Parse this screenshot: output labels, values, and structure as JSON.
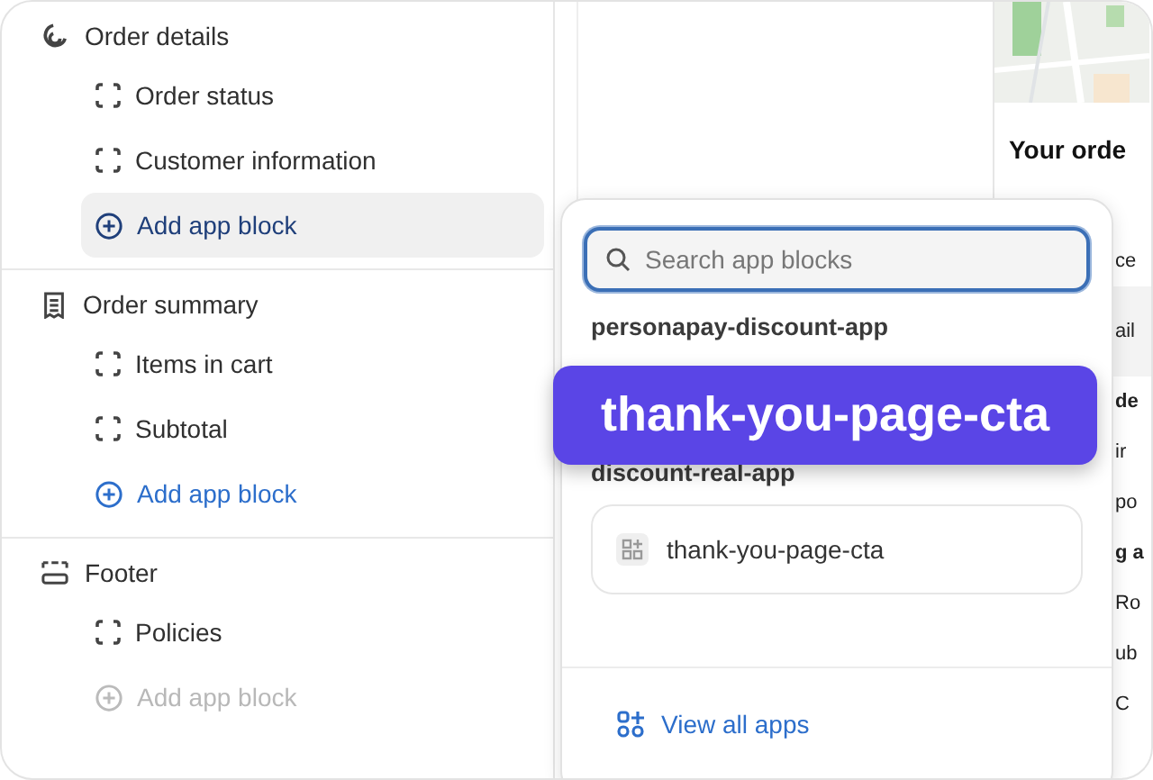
{
  "sections": [
    {
      "title": "Order details",
      "items": [
        {
          "kind": "block",
          "label": "Order status"
        },
        {
          "kind": "block",
          "label": "Customer information"
        },
        {
          "kind": "add",
          "label": "Add app block",
          "selected": true,
          "disabled": false
        }
      ]
    },
    {
      "title": "Order summary",
      "items": [
        {
          "kind": "block",
          "label": "Items in cart"
        },
        {
          "kind": "block",
          "label": "Subtotal"
        },
        {
          "kind": "add",
          "label": "Add app block",
          "selected": false,
          "disabled": false
        }
      ]
    },
    {
      "title": "Footer",
      "items": [
        {
          "kind": "block",
          "label": "Policies"
        },
        {
          "kind": "add",
          "label": "Add app block",
          "selected": false,
          "disabled": true
        }
      ]
    }
  ],
  "preview": {
    "heading": "Your orde",
    "fragments": [
      {
        "text": "ce",
        "bold": false,
        "shaded": false
      },
      {
        "text": "ail",
        "bold": false,
        "shaded": true
      },
      {
        "text": "de",
        "bold": true,
        "shaded": false
      },
      {
        "text": "ir",
        "bold": false,
        "shaded": false
      },
      {
        "text": "po",
        "bold": false,
        "shaded": false
      },
      {
        "text": "g a",
        "bold": true,
        "shaded": false
      },
      {
        "text": "Ro",
        "bold": false,
        "shaded": false
      },
      {
        "text": "ub",
        "bold": false,
        "shaded": false
      },
      {
        "text": "C",
        "bold": false,
        "shaded": false
      }
    ]
  },
  "popup": {
    "search": {
      "placeholder": "Search app blocks"
    },
    "groups": [
      {
        "name": "personapay-discount-app"
      },
      {
        "name": "discount-real-app",
        "blocks": [
          {
            "label": "thank-you-page-cta"
          }
        ]
      }
    ],
    "footer_link": "View all apps"
  },
  "callout": "thank-you-page-cta"
}
